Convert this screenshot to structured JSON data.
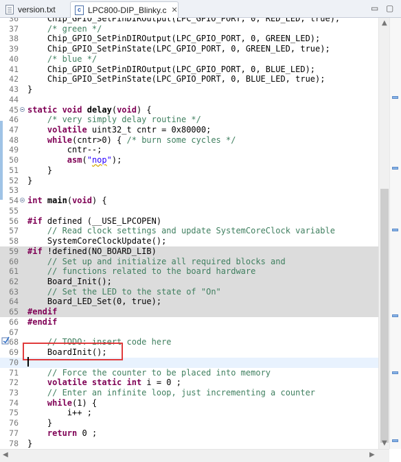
{
  "tabs": [
    {
      "label": "version.txt",
      "active": false
    },
    {
      "label": "LPC800-DIP_Blinky.c",
      "active": true
    }
  ],
  "close_symbol": "✕",
  "window_controls": {
    "minimize": "▭",
    "maximize": "▢"
  },
  "lines": [
    {
      "num": "36",
      "html": "    Chip_GPIO_SetPinDIROutput(LPC_GPIO_PORT, 0, RED_LED, true);"
    },
    {
      "num": "37",
      "html": "    <span class=\"cm\">/* green */</span>"
    },
    {
      "num": "38",
      "html": "    Chip_GPIO_SetPinDIROutput(LPC_GPIO_PORT, 0, GREEN_LED);"
    },
    {
      "num": "39",
      "html": "    Chip_GPIO_SetPinState(LPC_GPIO_PORT, 0, GREEN_LED, true);"
    },
    {
      "num": "40",
      "html": "    <span class=\"cm\">/* blue */</span>"
    },
    {
      "num": "41",
      "html": "    Chip_GPIO_SetPinDIROutput(LPC_GPIO_PORT, 0, BLUE_LED);"
    },
    {
      "num": "42",
      "html": "    Chip_GPIO_SetPinState(LPC_GPIO_PORT, 0, BLUE_LED, true);"
    },
    {
      "num": "43",
      "html": "}"
    },
    {
      "num": "44",
      "html": ""
    },
    {
      "num": "45",
      "html": "<span class=\"kw\">static void</span> <span class=\"fn\">delay</span>(<span class=\"kw\">void</span>) {",
      "fold": true
    },
    {
      "num": "46",
      "html": "    <span class=\"cm\">/* very simply delay routine */</span>"
    },
    {
      "num": "47",
      "html": "    <span class=\"kw\">volatile</span> uint32_t cntr = 0x80000;"
    },
    {
      "num": "48",
      "html": "    <span class=\"kw\">while</span>(cntr>0) { <span class=\"cm\">/* burn some cycles */</span>"
    },
    {
      "num": "49",
      "html": "        cntr--;"
    },
    {
      "num": "50",
      "html": "        <span class=\"kw\">asm</span>(<span class=\"st\">\"<span class=\"warnu\">nop</span>\"</span>);"
    },
    {
      "num": "51",
      "html": "    }"
    },
    {
      "num": "52",
      "html": "}"
    },
    {
      "num": "53",
      "html": ""
    },
    {
      "num": "54",
      "html": "<span class=\"kw\">int</span> <span class=\"fn\">main</span>(<span class=\"kw\">void</span>) {",
      "fold": true
    },
    {
      "num": "55",
      "html": ""
    },
    {
      "num": "56",
      "html": "<span class=\"kw\">#if</span> defined (__USE_LPCOPEN)"
    },
    {
      "num": "57",
      "html": "    <span class=\"cm\">// Read clock settings and update SystemCoreClock variable</span>"
    },
    {
      "num": "58",
      "html": "    SystemCoreClockUpdate();"
    },
    {
      "num": "59",
      "html": "<span class=\"kw\">#if</span> !defined(NO_BOARD_LIB)",
      "inactive": true
    },
    {
      "num": "60",
      "html": "    <span class=\"cm\">// Set up and initialize all required blocks and</span>",
      "inactive": true
    },
    {
      "num": "61",
      "html": "    <span class=\"cm\">// functions related to the board hardware</span>",
      "inactive": true
    },
    {
      "num": "62",
      "html": "    Board_Init();",
      "inactive": true
    },
    {
      "num": "63",
      "html": "    <span class=\"cm\">// Set the LED to the state of \"On\"</span>",
      "inactive": true
    },
    {
      "num": "64",
      "html": "    Board_LED_Set(0, true);",
      "inactive": true
    },
    {
      "num": "65",
      "html": "<span class=\"kw\">#endif</span>",
      "inactive": true
    },
    {
      "num": "66",
      "html": "<span class=\"kw\">#endif</span>"
    },
    {
      "num": "67",
      "html": ""
    },
    {
      "num": "68",
      "html": "    <span class=\"cm\">// TODO: insert code here</span>"
    },
    {
      "num": "69",
      "html": "    BoardInit();"
    },
    {
      "num": "70",
      "html": "",
      "current": true
    },
    {
      "num": "71",
      "html": "    <span class=\"cm\">// Force the counter to be placed into memory</span>"
    },
    {
      "num": "72",
      "html": "    <span class=\"kw\">volatile static int</span> i = 0 ;"
    },
    {
      "num": "73",
      "html": "    <span class=\"cm\">// Enter an infinite loop, just incrementing a counter</span>"
    },
    {
      "num": "74",
      "html": "    <span class=\"kw\">while</span>(1) {"
    },
    {
      "num": "75",
      "html": "        i++ ;"
    },
    {
      "num": "76",
      "html": "    }"
    },
    {
      "num": "77",
      "html": "    <span class=\"kw\">return</span> 0 ;"
    },
    {
      "num": "78",
      "html": "}"
    }
  ]
}
